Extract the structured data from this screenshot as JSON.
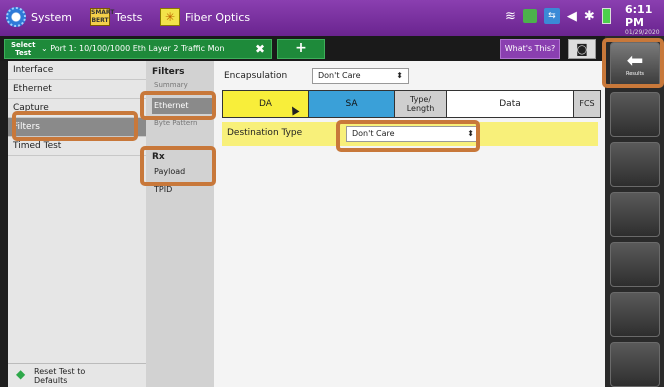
{
  "topbar": {
    "system_label": "System",
    "tests_label": "Tests",
    "tests_icon_text": "SMART BERT",
    "fiber_label": "Fiber Optics",
    "time": "6:11 PM",
    "date": "01/29/2020",
    "status_icons": [
      "wifi-icon",
      "cloud-check-icon",
      "usb-status-icon",
      "volume-icon",
      "bluetooth-icon",
      "battery-icon"
    ]
  },
  "tabbar": {
    "select_test_label": "Select\nTest",
    "port_label": "Port 1: 10/100/1000 Eth Layer 2 Traffic Mon",
    "add_label": "+",
    "whats_this_label": "What's This?"
  },
  "sidebar": {
    "items": [
      {
        "label": "Interface"
      },
      {
        "label": "Ethernet"
      },
      {
        "label": "Capture"
      },
      {
        "label": "Filters",
        "selected": true
      },
      {
        "label": "Timed Test"
      }
    ],
    "reset_label": "Reset Test to Defaults"
  },
  "subnav": {
    "filters_header": "Filters",
    "summary_label": "Summary",
    "ethernet_label": "Ethernet",
    "byte_pattern_label": "Byte Pattern",
    "rx_header": "Rx",
    "payload_label": "Payload",
    "tpid_label": "TPID"
  },
  "main": {
    "encapsulation_label": "Encapsulation",
    "encapsulation_value": "Don't Care",
    "fields": {
      "da": "DA",
      "sa": "SA",
      "type_length": "Type/ Length",
      "data": "Data",
      "fcs": "FCS"
    },
    "destination_type_label": "Destination Type",
    "destination_type_value": "Don't Care"
  },
  "rail": {
    "results_label": "Results"
  },
  "colors": {
    "highlight": "#c8783a",
    "accent_purple": "#7a2fa0",
    "da_yellow": "#f8ee3a",
    "sa_blue": "#3aa0d8"
  }
}
